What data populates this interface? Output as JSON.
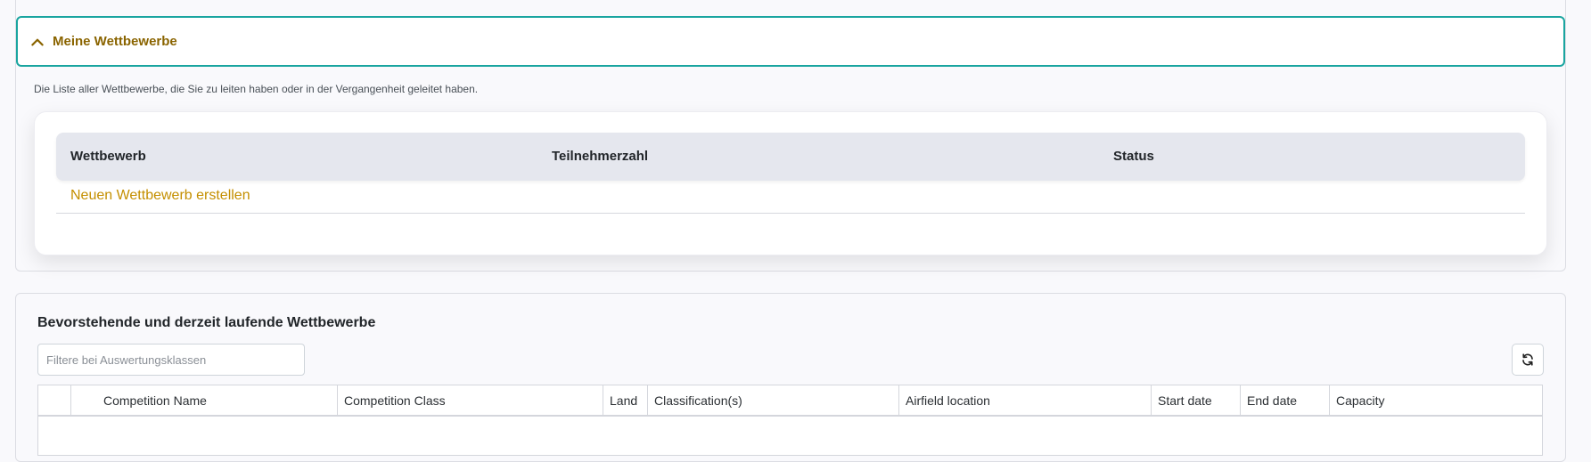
{
  "my_competitions": {
    "title": "Meine Wettbewerbe",
    "description": "Die Liste aller Wettbewerbe, die Sie zu leiten haben oder in der Vergangenheit geleitet haben.",
    "columns": [
      "Wettbewerb",
      "Teilnehmerzahl",
      "Status"
    ],
    "create_link": "Neuen Wettbewerb erstellen"
  },
  "upcoming": {
    "title": "Bevorstehende und derzeit laufende Wettbewerbe",
    "filter_placeholder": "Filtere bei Auswertungsklassen",
    "filter_value": "",
    "refresh_icon": "refresh-icon",
    "columns": [
      "Competition Name",
      "Competition Class",
      "Land",
      "Classification(s)",
      "Airfield location",
      "Start date",
      "End date",
      "Capacity"
    ]
  },
  "colors": {
    "accent_border": "#1aa5a0",
    "title_gold": "#8a6400",
    "link_gold": "#c48f00"
  }
}
